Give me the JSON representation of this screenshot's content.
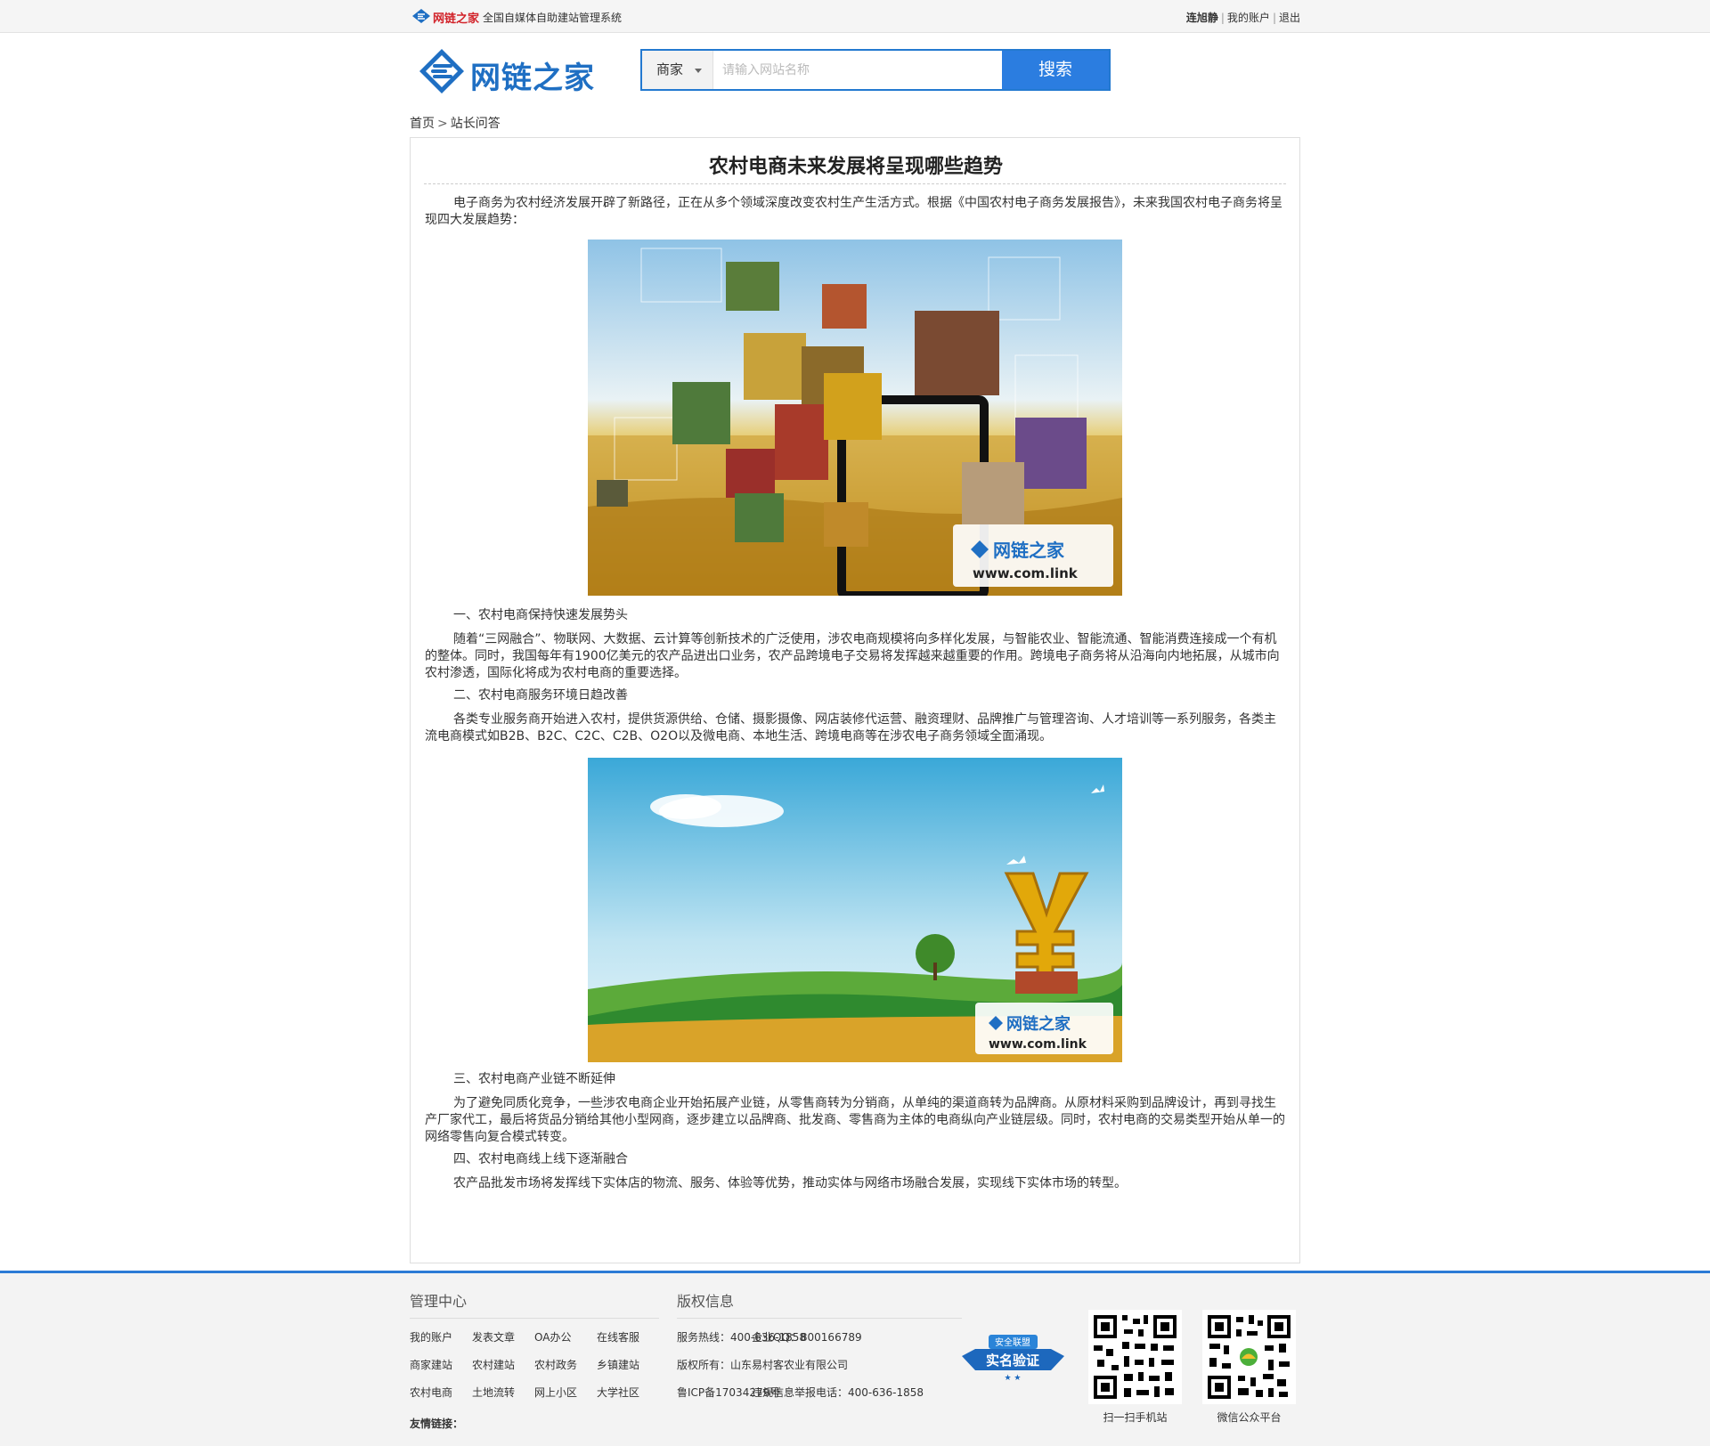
{
  "topbar": {
    "brand": "网链之家",
    "description": "全国自媒体自助建站管理系统",
    "username": "连旭静",
    "my_account": "我的账户",
    "logout": "退出"
  },
  "header": {
    "logo_text": "网链之家",
    "search": {
      "category": "商家",
      "placeholder": "请输入网站名称",
      "value": "",
      "button": "搜索"
    }
  },
  "breadcrumb": {
    "home": "首页",
    "separator": ">",
    "current": "站长问答"
  },
  "article": {
    "title": "农村电商未来发展将呈现哪些趋势",
    "intro": "电子商务为农村经济发展开辟了新路径，正在从多个领域深度改变农村生产生活方式。根据《中国农村电子商务发展报告》，未来我国农村电子商务将呈现四大发展趋势：",
    "image1_watermark": {
      "brand": "网链之家",
      "url": "www.com.link"
    },
    "section1_heading": "一、农村电商保持快速发展势头",
    "section1_text": "随着“三网融合”、物联网、大数据、云计算等创新技术的广泛使用，涉农电商规模将向多样化发展，与智能农业、智能流通、智能消费连接成一个有机的整体。同时，我国每年有1900亿美元的农产品进出口业务，农产品跨境电子交易将发挥越来越重要的作用。跨境电子商务将从沿海向内地拓展，从城市向农村渗透，国际化将成为农村电商的重要选择。",
    "section2_heading": "二、农村电商服务环境日趋改善",
    "section2_text": "各类专业服务商开始进入农村，提供货源供给、仓储、摄影摄像、网店装修代运营、融资理财、品牌推广与管理咨询、人才培训等一系列服务，各类主流电商模式如B2B、B2C、C2C、C2B、O2O以及微电商、本地生活、跨境电商等在涉农电子商务领域全面涌现。",
    "image2_watermark": {
      "brand": "网链之家",
      "url": "www.com.link"
    },
    "section3_heading": "三、农村电商产业链不断延伸",
    "section3_text": "为了避免同质化竞争，一些涉农电商企业开始拓展产业链，从零售商转为分销商，从单纯的渠道商转为品牌商。从原材料采购到品牌设计，再到寻找生产厂家代工，最后将货品分销给其他小型网商，逐步建立以品牌商、批发商、零售商为主体的电商纵向产业链层级。同时，农村电商的交易类型开始从单一的网络零售向复合模式转变。",
    "section4_heading": "四、农村电商线上线下逐渐融合",
    "section4_text": "农产品批发市场将发挥线下实体店的物流、服务、体验等优势，推动实体与网络市场融合发展，实现线下实体市场的转型。"
  },
  "footer": {
    "management_title": "管理中心",
    "management_links": [
      [
        "我的账户",
        "发表文章",
        "OA办公",
        "在线客服"
      ],
      [
        "商家建站",
        "农村建站",
        "农村政务",
        "乡镇建站"
      ],
      [
        "农村电商",
        "土地流转",
        "网上小区",
        "大学社区"
      ]
    ],
    "copyright_title": "版权信息",
    "hotline": "服务热线：400-636-1858",
    "qq": "企业QQ：800166789",
    "owner": "版权所有：山东易村客农业有限公司",
    "icp": "鲁ICP备17034279号",
    "report": "违规信息举报电话：400-636-1858",
    "badge_top": "安全联盟",
    "badge_main": "实名验证",
    "qr1_label": "扫一扫手机站",
    "qr2_label": "微信公众平台",
    "friend_links": "友情链接："
  },
  "colors": {
    "accent": "#2b7de0",
    "brand_red": "#d2232a",
    "footer_border": "#2c7bd6"
  }
}
